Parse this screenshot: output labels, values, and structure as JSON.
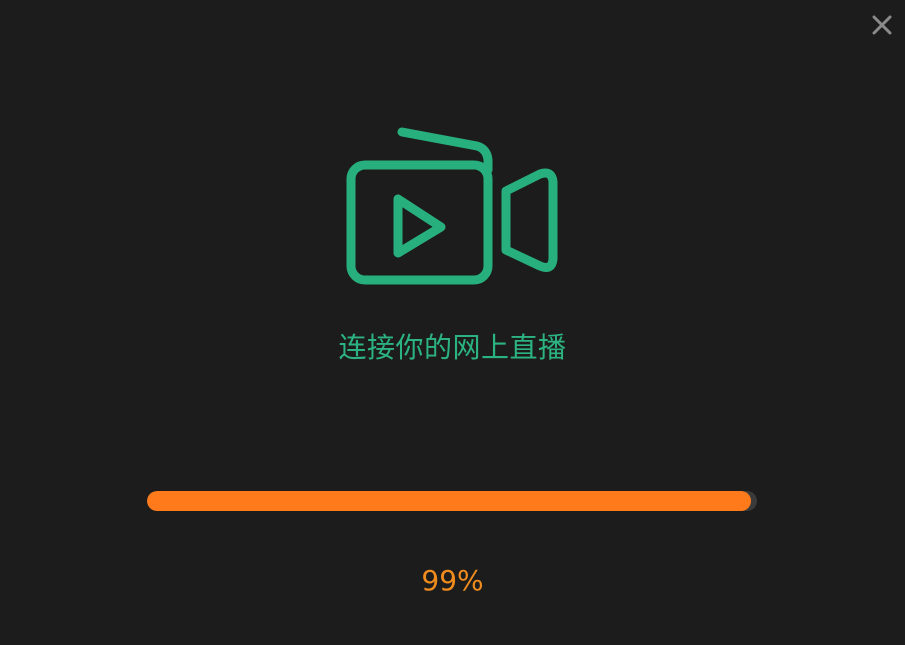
{
  "window": {
    "close_icon": "close-icon",
    "logo_icon": "video-camera-play-icon"
  },
  "main": {
    "title": "连接你的网上直播",
    "progress": {
      "value_percent": 99,
      "label": "99%"
    }
  },
  "colors": {
    "background": "#1c1c1c",
    "accent_green": "#27b07e",
    "progress_fill": "#ff7a1a",
    "percent_text": "#f08c1e",
    "close_icon": "#8a8a8a"
  }
}
